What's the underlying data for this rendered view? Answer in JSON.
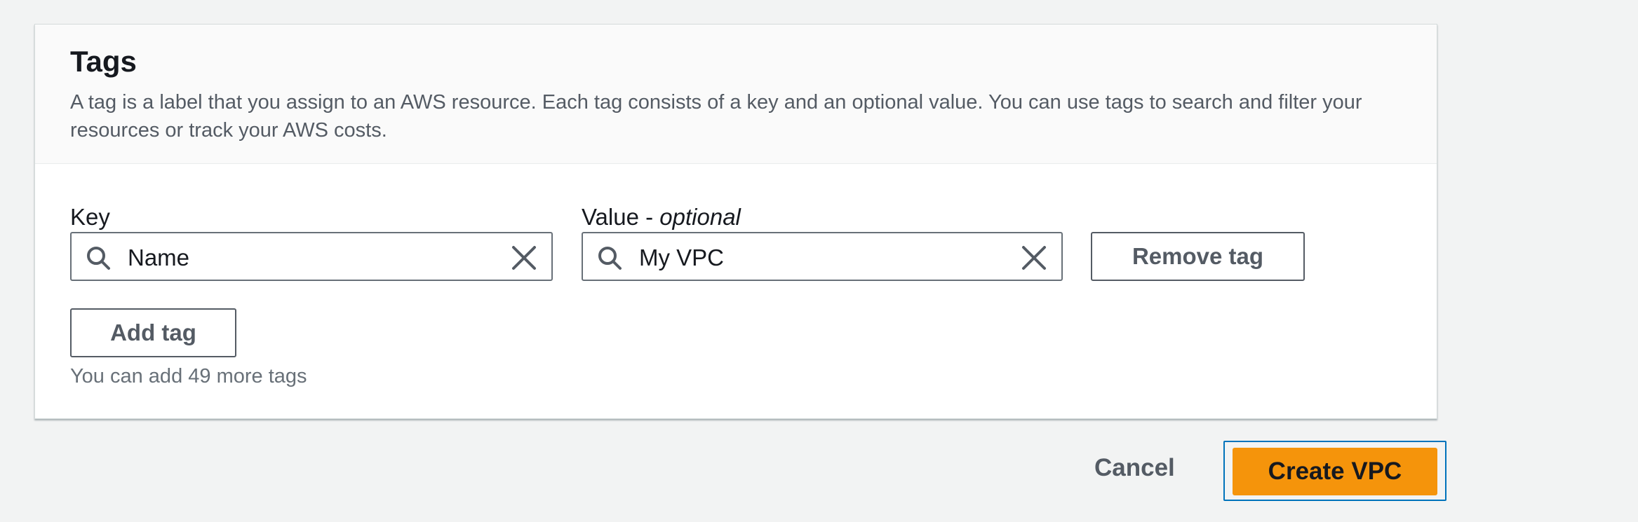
{
  "tags_panel": {
    "title": "Tags",
    "description": "A tag is a label that you assign to an AWS resource. Each tag consists of a key and an optional value. You can use tags to search and filter your resources or track your AWS costs.",
    "key_label": "Key",
    "value_label": "Value - ",
    "value_label_optional": "optional",
    "tags": [
      {
        "key": "Name",
        "value": "My VPC"
      }
    ],
    "remove_tag_label": "Remove tag",
    "add_tag_label": "Add tag",
    "remaining_hint": "You can add 49 more tags"
  },
  "footer": {
    "cancel_label": "Cancel",
    "create_label": "Create VPC"
  },
  "icons": {
    "search": "search-icon",
    "clear": "close-icon"
  },
  "colors": {
    "primary_button": "#f5940b",
    "focus_ring": "#0073bb",
    "page_background": "#f2f3f3"
  }
}
